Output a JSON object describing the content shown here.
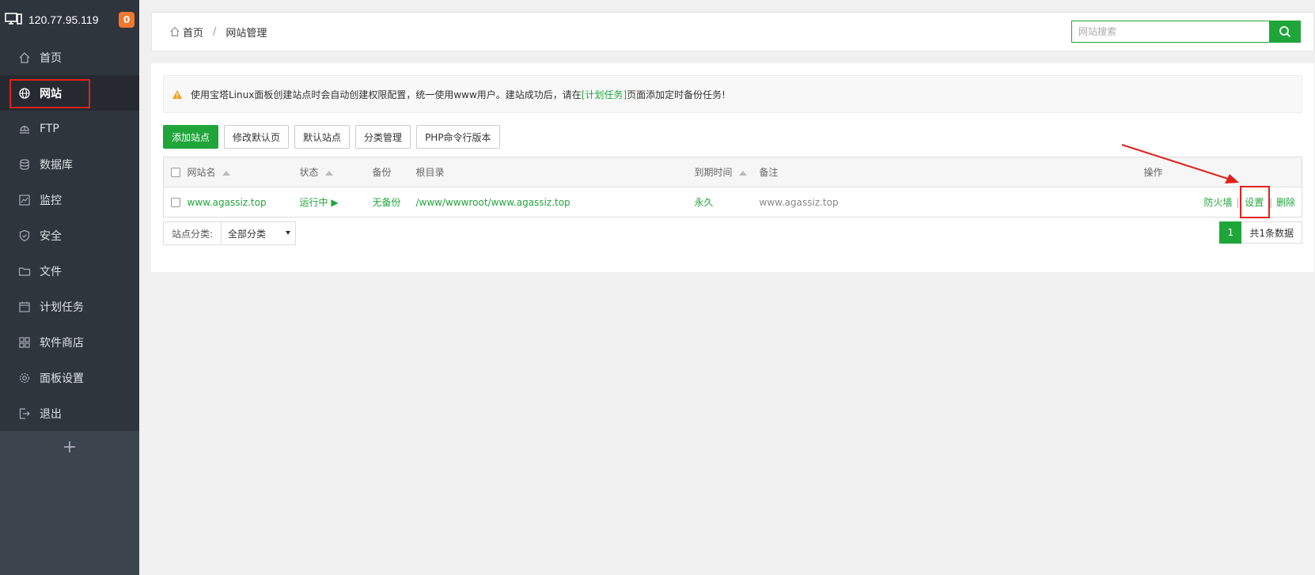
{
  "sidebar": {
    "ip": "120.77.95.119",
    "badge": "0",
    "items": [
      {
        "label": "首页",
        "icon": "home-icon"
      },
      {
        "label": "网站",
        "icon": "globe-icon",
        "active": true
      },
      {
        "label": "FTP",
        "icon": "ftp-icon"
      },
      {
        "label": "数据库",
        "icon": "database-icon"
      },
      {
        "label": "监控",
        "icon": "monitor-icon"
      },
      {
        "label": "安全",
        "icon": "shield-icon"
      },
      {
        "label": "文件",
        "icon": "folder-icon"
      },
      {
        "label": "计划任务",
        "icon": "calendar-icon"
      },
      {
        "label": "软件商店",
        "icon": "apps-icon"
      },
      {
        "label": "面板设置",
        "icon": "gear-icon"
      },
      {
        "label": "退出",
        "icon": "logout-icon"
      }
    ],
    "add": "+"
  },
  "header": {
    "breadcrumb_home": "首页",
    "breadcrumb_sep": "/",
    "breadcrumb_current": "网站管理",
    "search_placeholder": "网站搜索"
  },
  "notice": {
    "text_before": "使用宝塔Linux面板创建站点时会自动创建权限配置，统一使用www用户。建站成功后，请在",
    "link": "[计划任务]",
    "text_after": "页面添加定时备份任务!"
  },
  "toolbar": {
    "add_site": "添加站点",
    "edit_default_page": "修改默认页",
    "default_site": "默认站点",
    "category_mgmt": "分类管理",
    "php_cli": "PHP命令行版本"
  },
  "table": {
    "headers": {
      "name": "网站名",
      "status": "状态",
      "backup": "备份",
      "root": "根目录",
      "expire": "到期时间",
      "remark": "备注",
      "ops": "操作"
    },
    "rows": [
      {
        "name": "www.agassiz.top",
        "status": "运行中",
        "status_icon": "▶",
        "backup": "无备份",
        "root": "/www/wwwroot/www.agassiz.top",
        "expire": "永久",
        "remark": "www.agassiz.top",
        "op_firewall": "防火墙",
        "op_sep": "|",
        "op_settings": "设置",
        "op_delete": "删除"
      }
    ]
  },
  "footer": {
    "category_label": "站点分类:",
    "category_value": "全部分类",
    "page": "1",
    "total": "共1条数据"
  },
  "colors": {
    "accent": "#20a53a",
    "sidebar": "#3c444d",
    "highlight": "#e0211a"
  }
}
